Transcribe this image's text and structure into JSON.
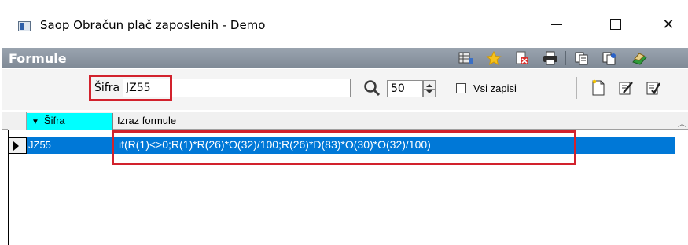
{
  "window": {
    "title": "Saop Obračun plač zaposlenih - Demo",
    "close_glyph": "✕"
  },
  "panel": {
    "title": "Formule",
    "header_icons": [
      "grid-list-icon",
      "star-icon",
      "delete-doc-icon",
      "printer-icon",
      "copy-icon",
      "paste-icon",
      "exit-book-icon"
    ]
  },
  "filter": {
    "label": "Šifra",
    "value": "JZ55",
    "count": "50",
    "all_records_label": "Vsi zapisi",
    "all_records_checked": false,
    "toolbar_icons": [
      "new-doc-icon",
      "edit-doc-icon",
      "edit-check-icon"
    ]
  },
  "grid": {
    "columns": [
      {
        "label": "Šifra",
        "sorted": "desc"
      },
      {
        "label": "Izraz formule"
      }
    ],
    "rows": [
      {
        "sifra": "JZ55",
        "izraz": "if(R(1)<>0;R(1)*R(26)*O(32)/100;R(26)*D(83)*O(30)*O(32)/100)",
        "selected": true
      }
    ]
  },
  "colors": {
    "highlight": "#d2222d",
    "selection": "#0078d7",
    "sorted_column": "#00ffff",
    "header_bar": "#8a95a1"
  }
}
